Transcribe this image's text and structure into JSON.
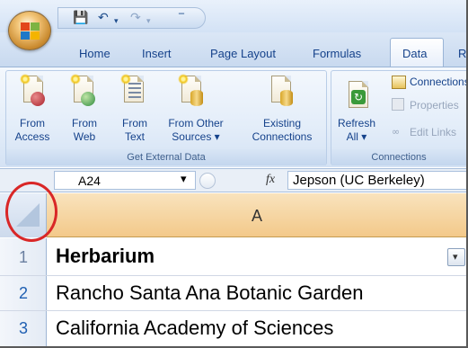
{
  "ribbon": {
    "tabs": [
      "Home",
      "Insert",
      "Page Layout",
      "Formulas",
      "Data",
      "R"
    ],
    "active_tab": "Data",
    "get_external_data": {
      "group_label": "Get External Data",
      "buttons": [
        {
          "line1": "From",
          "line2": "Access"
        },
        {
          "line1": "From",
          "line2": "Web"
        },
        {
          "line1": "From",
          "line2": "Text"
        },
        {
          "line1": "From Other",
          "line2": "Sources ▾"
        },
        {
          "line1": "Existing",
          "line2": "Connections"
        }
      ]
    },
    "connections": {
      "group_label": "Connections",
      "refresh": {
        "line1": "Refresh",
        "line2": "All ▾"
      },
      "connections_label": "Connections",
      "properties_label": "Properties",
      "edit_links_label": "Edit Links"
    }
  },
  "formula_bar": {
    "name_box": "A24",
    "fx": "fx",
    "formula": "Jepson (UC Berkeley)"
  },
  "grid": {
    "column_header": "A",
    "rows": [
      {
        "num": "1",
        "value": "Herbarium"
      },
      {
        "num": "2",
        "value": "Rancho Santa Ana Botanic Garden"
      },
      {
        "num": "3",
        "value": "California Academy of Sciences"
      }
    ]
  },
  "colors": {
    "accent_blue": "#15428b",
    "annotation_circle": "#d92727",
    "column_header_selected": "#f3c98a"
  }
}
